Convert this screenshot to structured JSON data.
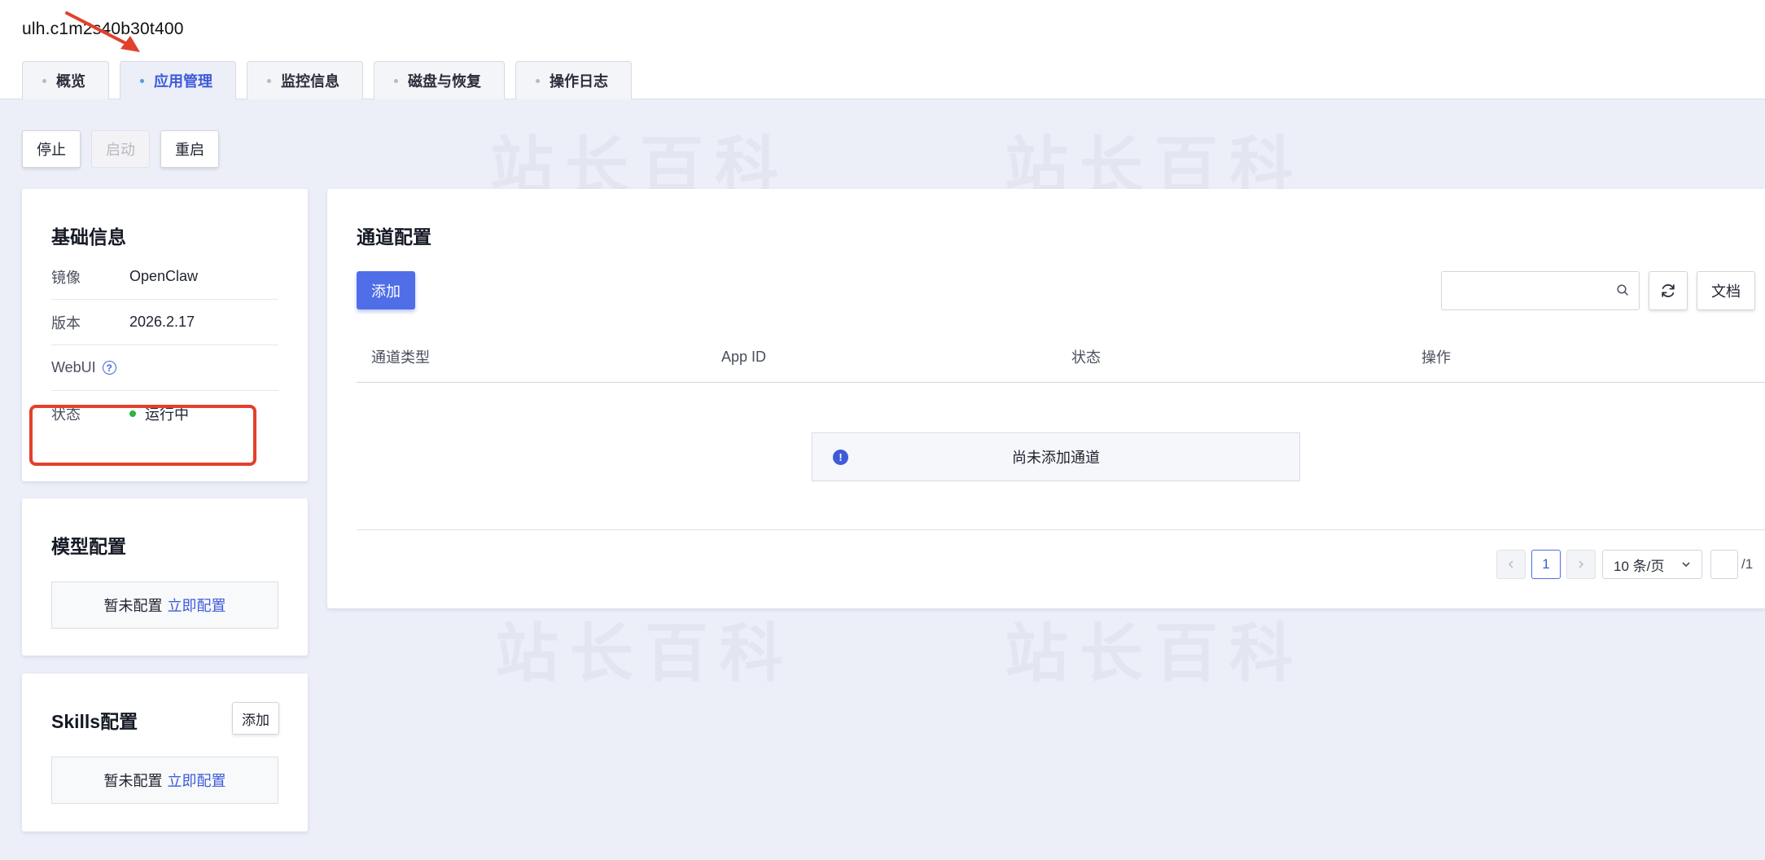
{
  "header": {
    "instance_id": "ulh.c1m2s40b30t400",
    "tabs": [
      {
        "label": "概览",
        "active": false
      },
      {
        "label": "应用管理",
        "active": true
      },
      {
        "label": "监控信息",
        "active": false
      },
      {
        "label": "磁盘与恢复",
        "active": false
      },
      {
        "label": "操作日志",
        "active": false
      }
    ]
  },
  "watermark_text": "站长百科",
  "actions": {
    "stop": "停止",
    "start": "启动",
    "restart": "重启"
  },
  "basic_info": {
    "title": "基础信息",
    "rows": [
      {
        "key": "镜像",
        "value": "OpenClaw"
      },
      {
        "key": "版本",
        "value": "2026.2.17"
      },
      {
        "key": "WebUI",
        "value": ""
      },
      {
        "key": "状态",
        "value": "运行中"
      }
    ],
    "status_color": "#2fb344"
  },
  "model_config": {
    "title": "模型配置",
    "empty_text": "暂未配置",
    "link": "立即配置"
  },
  "skills_config": {
    "title": "Skills配置",
    "add_label": "添加",
    "empty_text": "暂未配置",
    "link": "立即配置"
  },
  "channel_config": {
    "title": "通道配置",
    "add_label": "添加",
    "search_placeholder": "",
    "doc_label": "文档",
    "columns": [
      "通道类型",
      "App ID",
      "状态",
      "操作"
    ],
    "empty_notice": "尚未添加通道",
    "pagination": {
      "current_page": "1",
      "page_size": "10 条/页",
      "jump_value": "",
      "total_pages": "/1"
    }
  },
  "colors": {
    "accent": "#4f6ee8",
    "annotation": "#e2402c"
  }
}
